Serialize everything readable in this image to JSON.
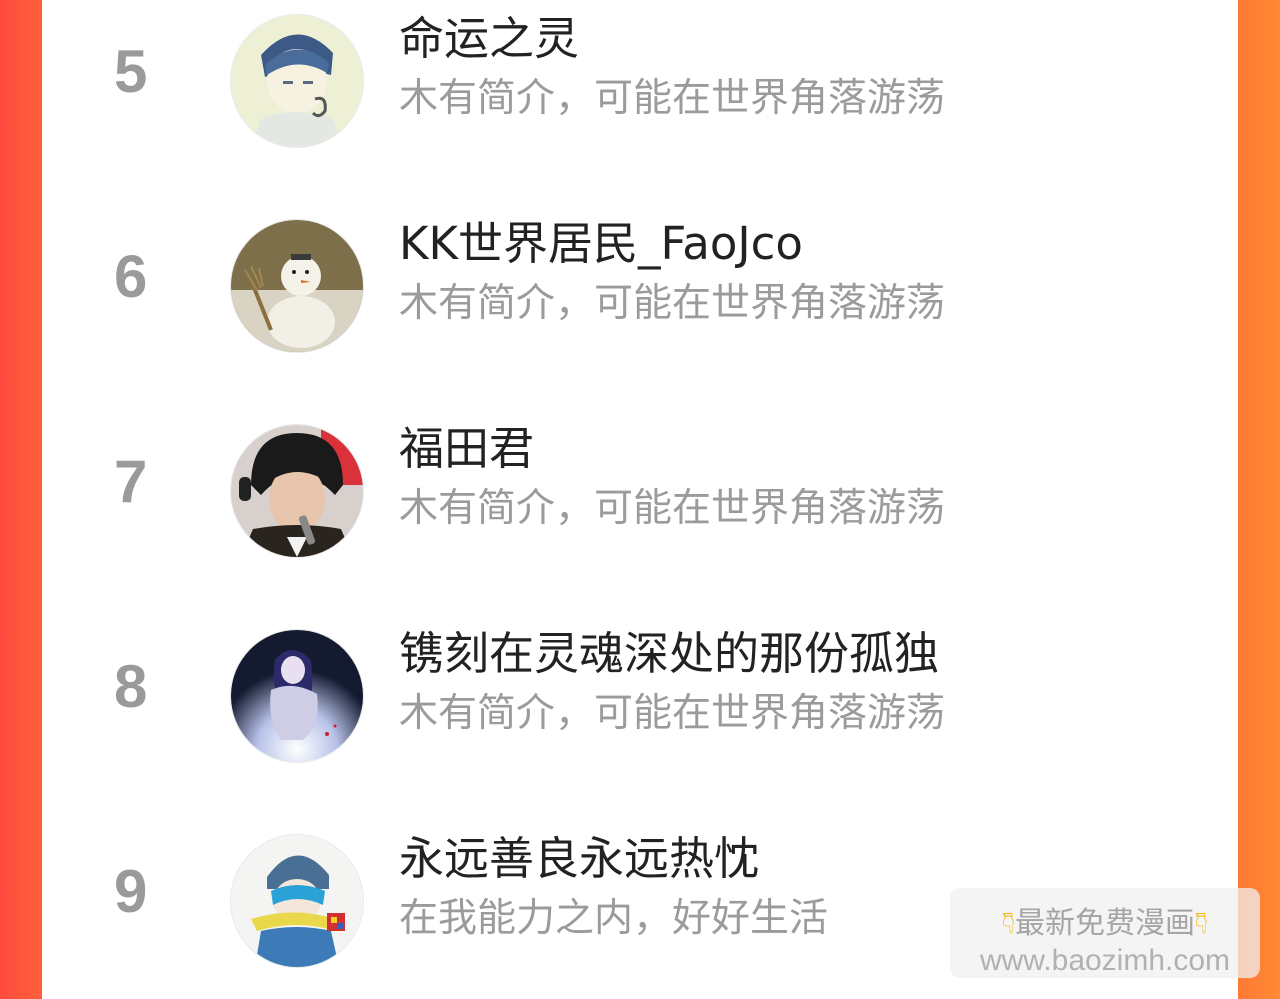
{
  "ranking": [
    {
      "rank": "5",
      "name": "命运之灵",
      "bio": "木有简介，可能在世界角落游荡",
      "avatar_icon": "anime-boy-avatar-icon"
    },
    {
      "rank": "6",
      "name": "KK世界居民_FaoJco",
      "bio": "木有简介，可能在世界角落游荡",
      "avatar_icon": "snowman-avatar-icon"
    },
    {
      "rank": "7",
      "name": "福田君",
      "bio": "木有简介，可能在世界角落游荡",
      "avatar_icon": "singer-photo-avatar-icon"
    },
    {
      "rank": "8",
      "name": "镌刻在灵魂深处的那份孤独",
      "bio": "木有简介，可能在世界角落游荡",
      "avatar_icon": "night-sky-girl-avatar-icon"
    },
    {
      "rank": "9",
      "name": "永远善良永远热忱",
      "bio": "在我能力之内，好好生活",
      "avatar_icon": "beanie-boy-avatar-icon"
    }
  ],
  "watermark": {
    "title": "最新免费漫画",
    "url": "www.baozimh.com",
    "hand_icon": "pointing-down-hand-icon"
  },
  "colors": {
    "background_gradient_left": "#ff4a3d",
    "background_gradient_right": "#ff8a34",
    "rank_text": "#9a9a9a",
    "name_text": "#222222",
    "bio_text": "#9b9b9b"
  }
}
